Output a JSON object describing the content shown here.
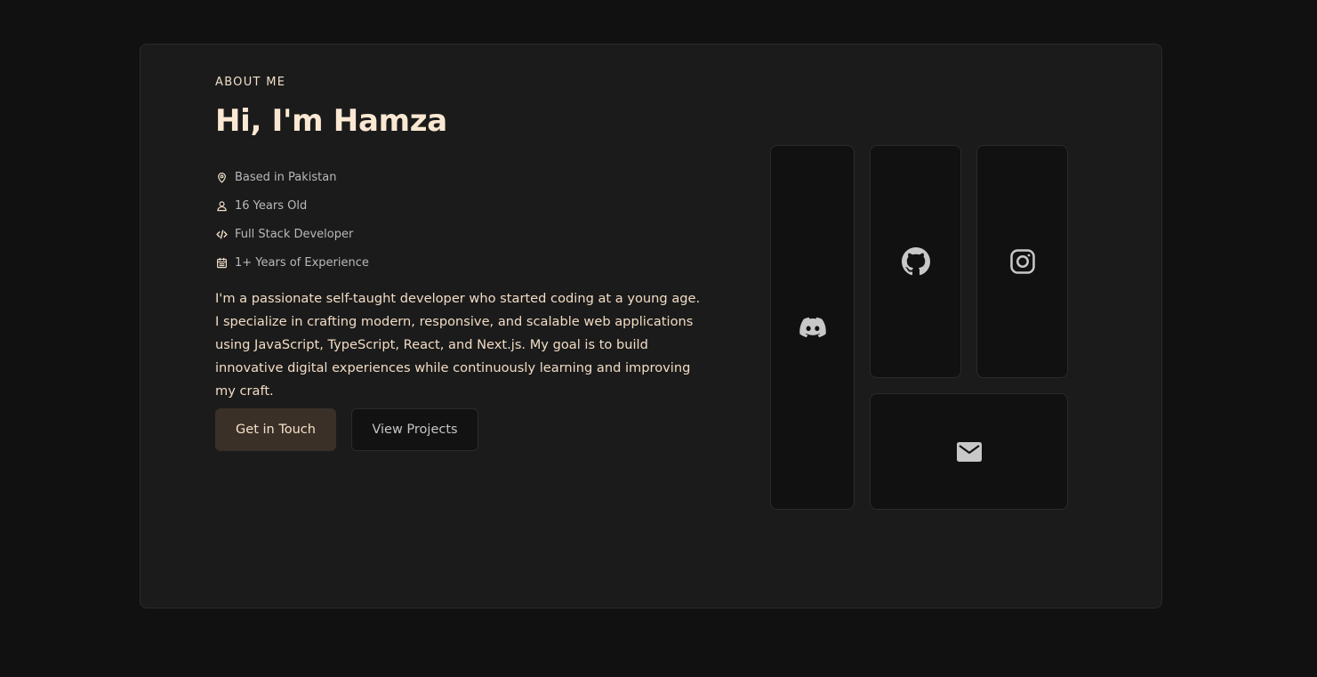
{
  "about": {
    "eyebrow": "ABOUT ME",
    "title": "Hi, I'm Hamza",
    "facts": [
      {
        "icon": "map-pin-icon",
        "text": "Based in Pakistan"
      },
      {
        "icon": "user-icon",
        "text": "16 Years Old"
      },
      {
        "icon": "code-icon",
        "text": "Full Stack Developer"
      },
      {
        "icon": "calendar-icon",
        "text": "1+ Years of Experience"
      }
    ],
    "bio": "I'm a passionate self-taught developer who started coding at a young age. I specialize in crafting modern, responsive, and scalable web applications using JavaScript, TypeScript, React, and Next.js. My goal is to build innovative digital experiences while continuously learning and improving my craft.",
    "buttons": {
      "primary": "Get in Touch",
      "secondary": "View Projects"
    }
  },
  "socials": [
    {
      "id": "discord",
      "icon": "discord-icon"
    },
    {
      "id": "github",
      "icon": "github-icon"
    },
    {
      "id": "instagram",
      "icon": "instagram-icon"
    },
    {
      "id": "email",
      "icon": "mail-icon"
    }
  ],
  "colors": {
    "page_background": "#111111",
    "card_background": "#1b1b1b",
    "accent_text": "#fbe8d3",
    "primary_button": "#3a3028",
    "icon": "#c8c8c8"
  }
}
